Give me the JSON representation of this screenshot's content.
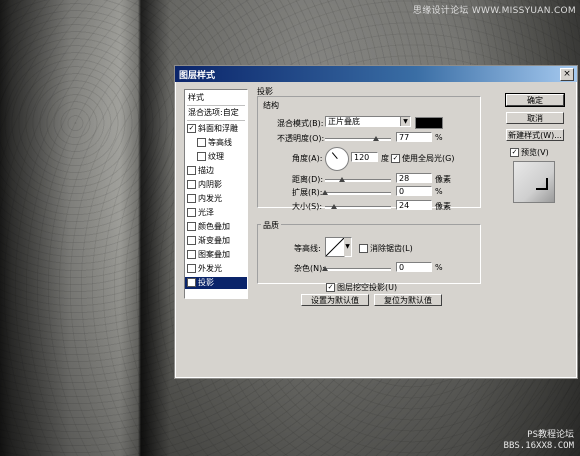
{
  "watermarks": {
    "top": "思缘设计论坛 WWW.MISSYUAN.COM",
    "bottom_line1": "PS教程论坛",
    "bottom_line2": "BBS.16XX8.COM"
  },
  "dialog": {
    "title": "图层样式",
    "close_glyph": "×"
  },
  "style_list": {
    "header": "样式",
    "blend_options": "混合选项:自定",
    "items": [
      {
        "label": "斜面和浮雕",
        "checked": true,
        "indent": false
      },
      {
        "label": "等高线",
        "checked": false,
        "indent": true
      },
      {
        "label": "纹理",
        "checked": false,
        "indent": true
      },
      {
        "label": "描边",
        "checked": false,
        "indent": false
      },
      {
        "label": "内阴影",
        "checked": false,
        "indent": false
      },
      {
        "label": "内发光",
        "checked": false,
        "indent": false
      },
      {
        "label": "光泽",
        "checked": false,
        "indent": false
      },
      {
        "label": "颜色叠加",
        "checked": false,
        "indent": false
      },
      {
        "label": "渐变叠加",
        "checked": false,
        "indent": false
      },
      {
        "label": "图案叠加",
        "checked": false,
        "indent": false
      },
      {
        "label": "外发光",
        "checked": false,
        "indent": false
      },
      {
        "label": "投影",
        "checked": true,
        "indent": false,
        "selected": true
      }
    ]
  },
  "drop_shadow": {
    "section_title": "投影",
    "structure_title": "结构",
    "blend_mode_label": "混合模式(B):",
    "blend_mode_value": "正片叠底",
    "shadow_color": "#000000",
    "opacity_label": "不透明度(O):",
    "opacity_value": "77",
    "percent": "%",
    "angle_label": "角度(A):",
    "angle_value": "120",
    "angle_unit": "度",
    "global_light_label": "使用全局光(G)",
    "global_light_checked": true,
    "distance_label": "距离(D):",
    "distance_value": "28",
    "spread_label": "扩展(R):",
    "spread_value": "0",
    "size_label": "大小(S):",
    "size_value": "24",
    "pixel_unit": "像素",
    "quality_title": "品质",
    "contour_label": "等高线:",
    "anti_alias_label": "消除锯齿(L)",
    "anti_alias_checked": false,
    "noise_label": "杂色(N):",
    "noise_value": "0",
    "knockout_label": "图层挖空投影(U)",
    "knockout_checked": true,
    "set_default_label": "设置为默认值",
    "reset_default_label": "复位为默认值"
  },
  "buttons": {
    "ok": "确定",
    "cancel": "取消",
    "new_style": "新建样式(W)...",
    "preview_label": "预览(V)",
    "preview_checked": true
  },
  "colors": {
    "titlebar_start": "#0a246a",
    "titlebar_end": "#a6caf0",
    "selection": "#0a246a",
    "dialog_bg": "#d6d3ce"
  }
}
